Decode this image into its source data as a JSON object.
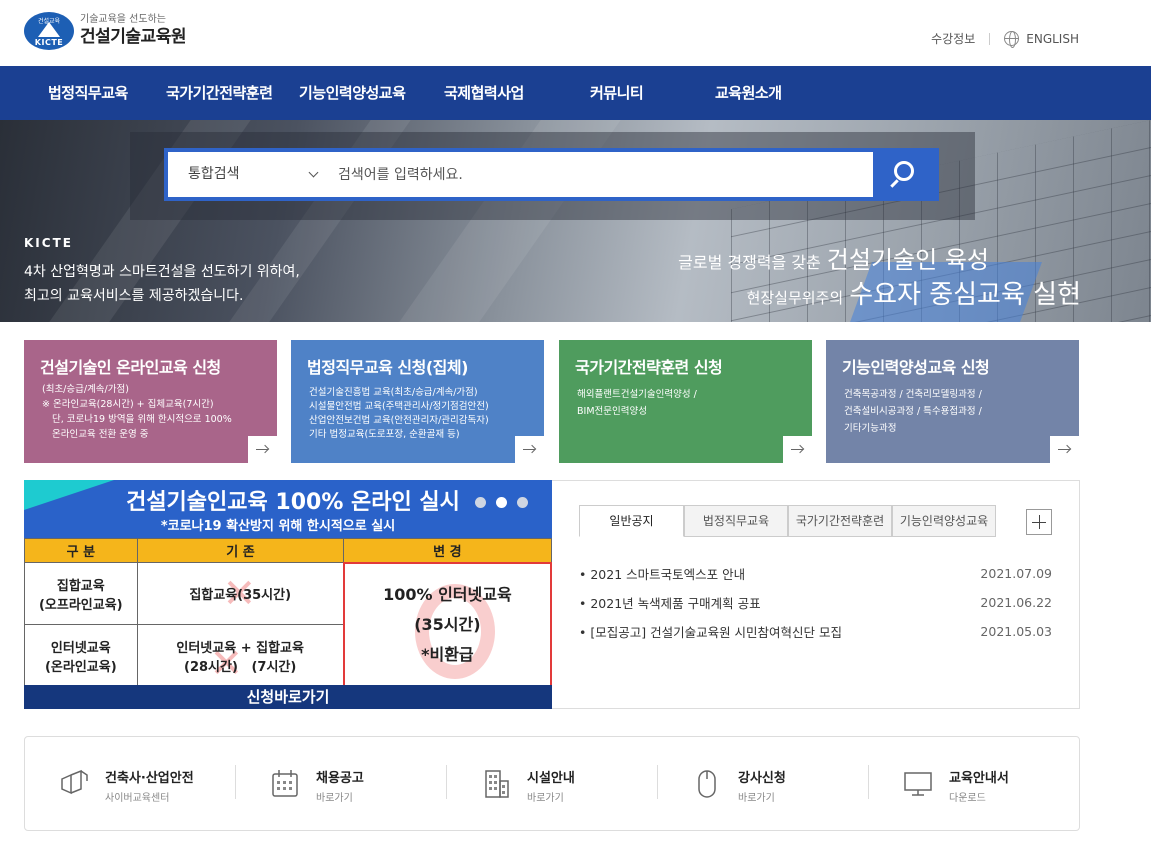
{
  "header": {
    "logo_badge_top": "건설교육",
    "logo_badge_bottom": "KICTE",
    "logo_sub": "기술교육을 선도하는",
    "logo_main": "건설기술교육원",
    "util_links": [
      "수강정보",
      "ENGLISH"
    ]
  },
  "nav": {
    "items": [
      "법정직무교육",
      "국가기간전략훈련",
      "기능인력양성교육",
      "국제협력사업",
      "커뮤니티",
      "교육원소개"
    ]
  },
  "hero": {
    "search_select": "통합검색",
    "search_placeholder": "검색어를 입력하세요.",
    "brand": "KICTE",
    "desc_line1": "4차 산업혁명과 스마트건설을 선도하기 위하여,",
    "desc_line2": "최고의 교육서비스를 제공하겠습니다.",
    "slogan1_small": "글로벌 경쟁력을 갖춘",
    "slogan1_big": "건설기술인 육성",
    "slogan2_small": "현장실무위주의",
    "slogan2_big": "수요자 중심교육 실현"
  },
  "cards": [
    {
      "title": "건설기술인 온라인교육 신청",
      "lines": [
        "(최초/승급/계속/가점)",
        "※ 온라인교육(28시간) + 집체교육(7시간)",
        "   단, 코로나19 방역을 위해 한시적으로 100%",
        "   온라인교육 전환 운영 중"
      ],
      "color": "#a9658a"
    },
    {
      "title": "법정직무교육 신청(집체)",
      "lines": [
        "건설기술진흥법 교육(최초/승급/계속/가점)",
        "시설물안전법 교육(주택관리사/정기점검안전)",
        "산업안전보건법 교육(안전관리자/관리감독자)",
        "기타 법정교육(도로포장, 순환골재 등)"
      ],
      "color": "#4f82c7"
    },
    {
      "title": "국가기간전략훈련 신청",
      "lines": [
        "해외플랜트건설기술인력양성 /",
        "BIM전문인력양성"
      ],
      "color": "#4f9c5e"
    },
    {
      "title": "기능인력양성교육 신청",
      "lines": [
        "건축목공과정 / 건축리모델링과정 /",
        "건축설비시공과정 / 특수용접과정 /",
        "기타기능과정"
      ],
      "color": "#7384a8"
    }
  ],
  "banner": {
    "title": "건설기술인교육 100% 온라인 실시",
    "subtitle": "*코로나19 확산방지 위해 한시적으로 실시",
    "headers": [
      "구 분",
      "기 존",
      "변 경"
    ],
    "row1_label": [
      "집합교육",
      "(오프라인교육)"
    ],
    "row1_before": "집합교육(35시간)",
    "row2_label": [
      "인터넷교육",
      "(온라인교육)"
    ],
    "row2_before": [
      "인터넷교육 + 집합교육",
      "(28시간)   (7시간)"
    ],
    "after": [
      "100% 인터넷교육",
      "(35시간)",
      "*비환급"
    ],
    "footer": "신청바로가기"
  },
  "notice": {
    "tabs": [
      "일반공지",
      "법정직무교육",
      "국가기간전략훈련",
      "기능인력양성교육"
    ],
    "items": [
      {
        "title": "2021 스마트국토엑스포 안내",
        "date": "2021.07.09"
      },
      {
        "title": "2021년 녹색제품 구매계획 공표",
        "date": "2021.06.22"
      },
      {
        "title": "[모집공고] 건설기술교육원 시민참여혁신단 모집",
        "date": "2021.05.03"
      }
    ]
  },
  "quick": [
    {
      "title": "건축사·산업안전",
      "sub": "사이버교육센터",
      "icon": "building-blocks-icon"
    },
    {
      "title": "채용공고",
      "sub": "바로가기",
      "icon": "calendar-icon"
    },
    {
      "title": "시설안내",
      "sub": "바로가기",
      "icon": "office-building-icon"
    },
    {
      "title": "강사신청",
      "sub": "바로가기",
      "icon": "mouse-icon"
    },
    {
      "title": "교육안내서",
      "sub": "다운로드",
      "icon": "monitor-icon"
    }
  ]
}
